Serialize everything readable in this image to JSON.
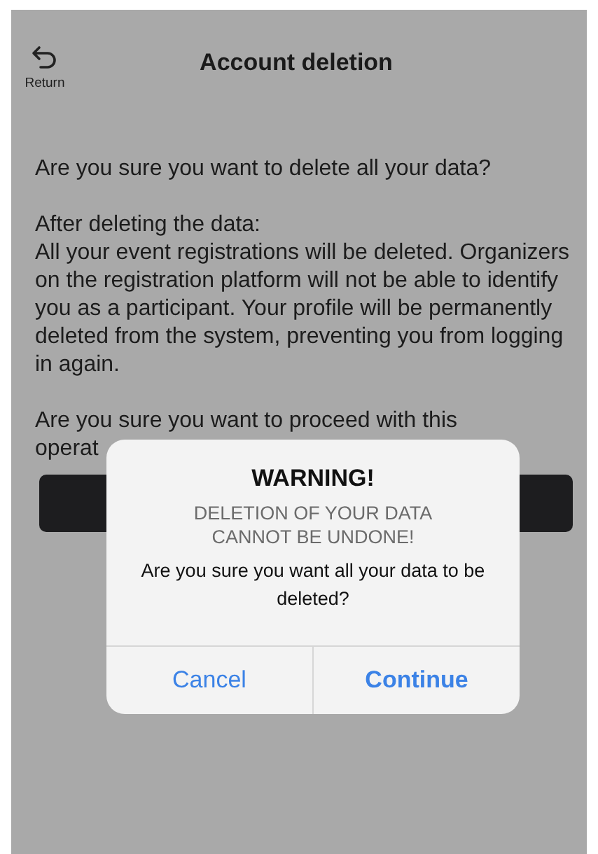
{
  "header": {
    "back_label": "Return",
    "title": "Account deletion"
  },
  "content": {
    "question": "Are you sure you want to delete all your data?",
    "details_heading": "After deleting the data:",
    "details": "All your event registrations will be deleted. Organizers on the registration platform will not be able to identify you as a participant. Your profile will be permanently deleted from the system, preventing you from logging in again.",
    "confirm_question": "Are you sure you want to proceed with this operat"
  },
  "dialog": {
    "title": "WARNING!",
    "subtitle": "DELETION OF YOUR DATA CANNOT BE UNDONE!",
    "message": "Are you sure you want all your data to be deleted?",
    "buttons": [
      {
        "label": "Cancel",
        "kind": "cancel"
      },
      {
        "label": "Continue",
        "kind": "primary"
      }
    ]
  }
}
